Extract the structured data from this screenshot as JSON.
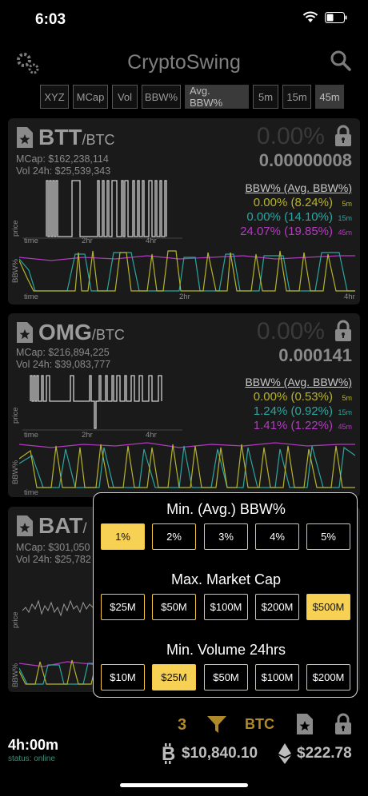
{
  "status_bar": {
    "time": "6:03"
  },
  "header": {
    "title": "CryptoSwing"
  },
  "sort_tabs": [
    {
      "label": "XYZ",
      "active": false
    },
    {
      "label": "MCap",
      "active": false
    },
    {
      "label": "Vol",
      "active": false
    },
    {
      "label": "BBW%",
      "active": false
    },
    {
      "label": "Avg. BBW%",
      "active": true
    },
    {
      "label": "5m",
      "active": false
    },
    {
      "label": "15m",
      "active": false
    },
    {
      "label": "45m",
      "active": true
    }
  ],
  "cards": [
    {
      "symbol": "BTT",
      "base": "/BTC",
      "mcap": "MCap: $162,238,114",
      "vol": "Vol 24h: $25,539,343",
      "change": "0.00%",
      "price": "0.00000008",
      "bbw_header": "BBW% (Avg. BBW%)",
      "bbw": [
        {
          "value": "0.00% (8.24%)",
          "tf": "5m",
          "color": "#b6b32a"
        },
        {
          "value": "0.00% (14.10%)",
          "tf": "15m",
          "color": "#2aa6a0"
        },
        {
          "value": "24.07% (19.85%)",
          "tf": "45m",
          "color": "#b23bbf"
        }
      ],
      "price_axis": {
        "ylabel": "price",
        "ticks": [
          "time",
          "2hr",
          "4hr"
        ]
      },
      "bbw_axis": {
        "ylabel": "BBW%",
        "ticks": [
          "time",
          "2hr",
          "4hr"
        ]
      }
    },
    {
      "symbol": "OMG",
      "base": "/BTC",
      "mcap": "MCap: $216,894,225",
      "vol": "Vol 24h: $39,083,777",
      "change": "0.00%",
      "price": "0.000141",
      "bbw_header": "BBW% (Avg. BBW%)",
      "bbw": [
        {
          "value": "0.00% (0.53%)",
          "tf": "5m",
          "color": "#b6b32a"
        },
        {
          "value": "1.24% (0.92%)",
          "tf": "15m",
          "color": "#2aa6a0"
        },
        {
          "value": "1.41% (1.22%)",
          "tf": "45m",
          "color": "#b23bbf"
        }
      ],
      "price_axis": {
        "ylabel": "price",
        "ticks": [
          "time",
          "2hr",
          "4hr"
        ]
      },
      "bbw_axis": {
        "ylabel": "BBW%",
        "ticks": [
          "time"
        ]
      }
    },
    {
      "symbol": "BAT",
      "base": "/",
      "mcap": "MCap: $301,050",
      "vol": "Vol 24h: $25,782",
      "price_axis": {
        "ylabel": "price"
      },
      "bbw_axis": {
        "ylabel": "BBW%"
      }
    }
  ],
  "filter": {
    "bbw_title": "Min. (Avg.) BBW%",
    "bbw_options": [
      {
        "label": "1%",
        "selected": true
      },
      {
        "label": "2%",
        "selected": false
      },
      {
        "label": "3%",
        "selected": false
      },
      {
        "label": "4%",
        "selected": false
      },
      {
        "label": "5%",
        "selected": false
      }
    ],
    "mcap_title": "Max. Market Cap",
    "mcap_options": [
      {
        "label": "$25M",
        "selected": false
      },
      {
        "label": "$50M",
        "selected": false
      },
      {
        "label": "$100M",
        "selected": false
      },
      {
        "label": "$200M",
        "selected": false
      },
      {
        "label": "$500M",
        "selected": true
      }
    ],
    "vol_title": "Min. Volume 24hrs",
    "vol_options": [
      {
        "label": "$10M",
        "selected": false
      },
      {
        "label": "$25M",
        "selected": true
      },
      {
        "label": "$50M",
        "selected": false
      },
      {
        "label": "$100M",
        "selected": false
      },
      {
        "label": "$200M",
        "selected": false
      }
    ]
  },
  "footer": {
    "count": "3",
    "currency": "BTC",
    "timer": "4h:00m",
    "status": "status: online",
    "btc_price": "$10,840.10",
    "eth_price": "$222.78"
  },
  "colors": {
    "accent": "#f7d154",
    "bbw5m": "#b6b32a",
    "bbw15m": "#2aa6a0",
    "bbw45m": "#b23bbf"
  }
}
